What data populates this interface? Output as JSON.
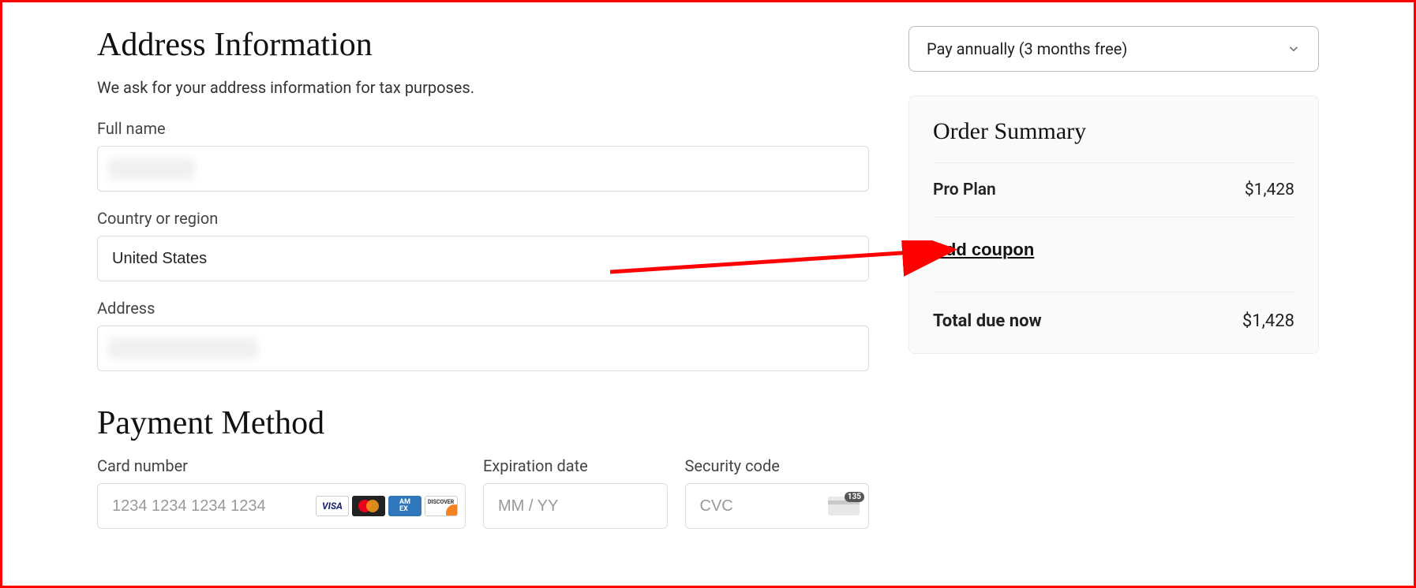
{
  "address": {
    "title": "Address Information",
    "subtitle": "We ask for your address information for tax purposes.",
    "full_name_label": "Full name",
    "full_name_value": "",
    "country_label": "Country or region",
    "country_value": "United States",
    "address_label": "Address",
    "address_value": ""
  },
  "payment": {
    "title": "Payment Method",
    "card_label": "Card number",
    "card_placeholder": "1234 1234 1234 1234",
    "exp_label": "Expiration date",
    "exp_placeholder": "MM / YY",
    "cvc_label": "Security code",
    "cvc_placeholder": "CVC",
    "cvc_badge": "135"
  },
  "billing_select": {
    "selected": "Pay annually (3 months free)"
  },
  "summary": {
    "title": "Order Summary",
    "plan_label": "Pro Plan",
    "plan_price": "$1,428",
    "coupon_label": "Add coupon",
    "total_label": "Total due now",
    "total_price": "$1,428"
  }
}
